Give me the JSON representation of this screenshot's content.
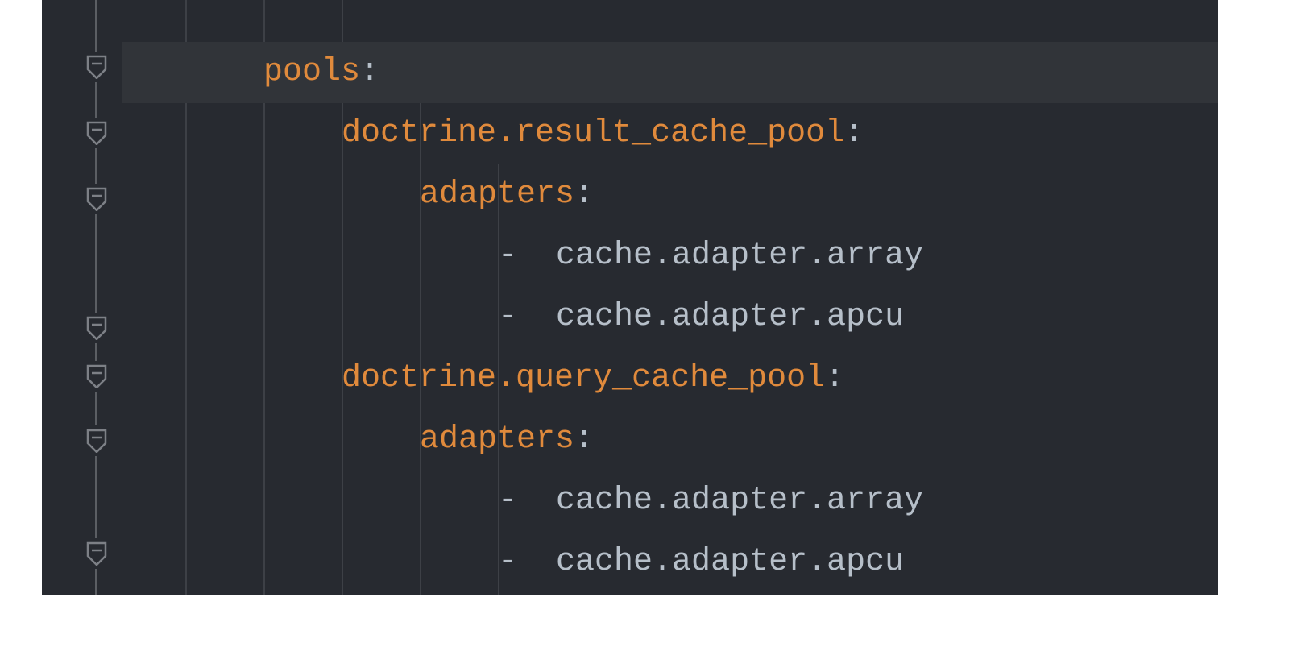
{
  "lines": {
    "l1_key": "pools",
    "l1_colon": ":",
    "l2_key": "doctrine.result_cache_pool",
    "l2_colon": ":",
    "l3_key": "adapters",
    "l3_colon": ":",
    "l4_dash": "-",
    "l4_val": "cache.adapter.array",
    "l5_dash": "-",
    "l5_val": "cache.adapter.apcu",
    "l6_key": "doctrine.query_cache_pool",
    "l6_colon": ":",
    "l7_key": "adapters",
    "l7_colon": ":",
    "l8_dash": "-",
    "l8_val": "cache.adapter.array",
    "l9_dash": "-",
    "l9_val": "cache.adapter.apcu"
  }
}
